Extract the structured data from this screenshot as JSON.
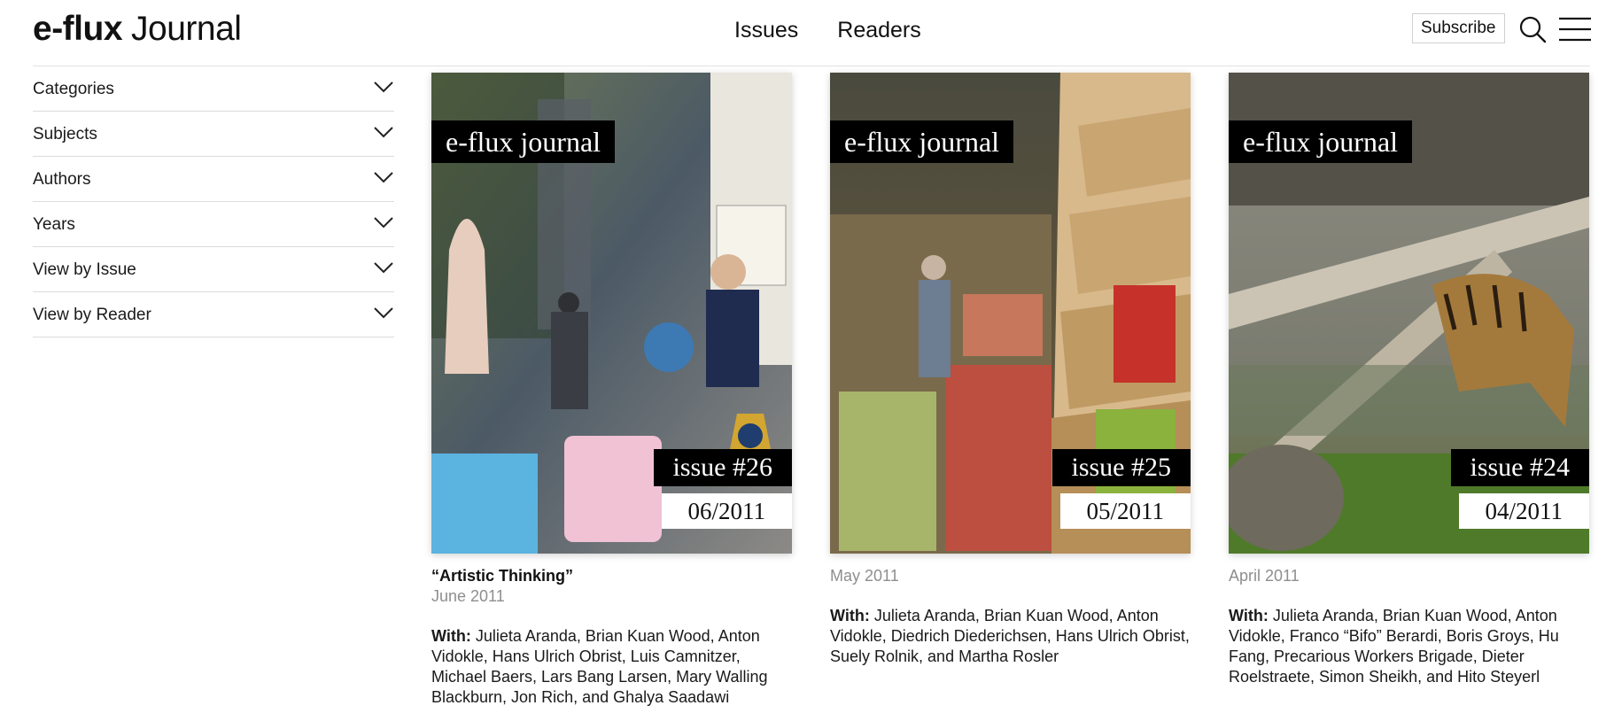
{
  "header": {
    "logo_brand": "e-flux",
    "logo_word": "Journal",
    "nav": [
      "Issues",
      "Readers"
    ],
    "subscribe_label": "Subscribe"
  },
  "sidebar": {
    "filters": [
      "Categories",
      "Subjects",
      "Authors",
      "Years",
      "View by Issue",
      "View by Reader"
    ]
  },
  "issues": [
    {
      "masthead": "e-flux journal",
      "number": "issue #26",
      "cover_date": "06/2011",
      "title": "“Artistic Thinking”",
      "date": "June 2011",
      "with_label": "With:",
      "contributors": "Julieta Aranda, Brian Kuan Wood, Anton Vidokle, Hans Ulrich Obrist, Luis Camnitzer, Michael Baers, Lars Bang Larsen, Mary Walling Blackburn, Jon Rich, and Ghalya Saadawi"
    },
    {
      "masthead": "e-flux journal",
      "number": "issue #25",
      "cover_date": "05/2011",
      "title": "",
      "date": "May 2011",
      "with_label": "With:",
      "contributors": "Julieta Aranda, Brian Kuan Wood, Anton Vidokle, Diedrich Diederichsen, Hans Ulrich Obrist, Suely Rolnik, and Martha Rosler"
    },
    {
      "masthead": "e-flux journal",
      "number": "issue #24",
      "cover_date": "04/2011",
      "title": "",
      "date": "April 2011",
      "with_label": "With:",
      "contributors": "Julieta Aranda, Brian Kuan Wood, Anton Vidokle, Franco “Bifo” Berardi, Boris Groys, Hu Fang, Precarious Workers Brigade, Dieter Roelstraete, Simon Sheikh, and Hito Steyerl"
    }
  ]
}
